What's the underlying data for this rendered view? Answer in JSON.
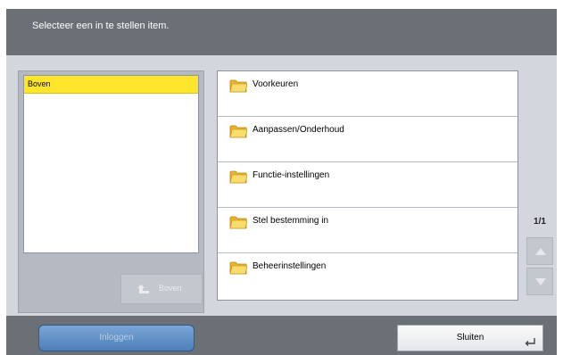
{
  "header": {
    "instruction": "Selecteer een in te stellen item."
  },
  "tree": {
    "items": [
      {
        "label": "Boven",
        "selected": true
      }
    ],
    "back_label": "Boven"
  },
  "list": {
    "items": [
      {
        "label": "Voorkeuren",
        "icon": "folder-icon"
      },
      {
        "label": "Aanpassen/Onderhoud",
        "icon": "folder-icon"
      },
      {
        "label": "Functie-instellingen",
        "icon": "folder-icon"
      },
      {
        "label": "Stel bestemming in",
        "icon": "folder-icon"
      },
      {
        "label": "Beheerinstellingen",
        "icon": "folder-icon"
      }
    ]
  },
  "pager": {
    "page": "1/1"
  },
  "footer": {
    "login_label": "Inloggen",
    "close_label": "Sluiten"
  },
  "colors": {
    "header_bg": "#6b6f76",
    "selected_bg": "#ffe52b",
    "login_blue": "#4e7fb8",
    "folder_yellow": "#f6cd3e"
  }
}
